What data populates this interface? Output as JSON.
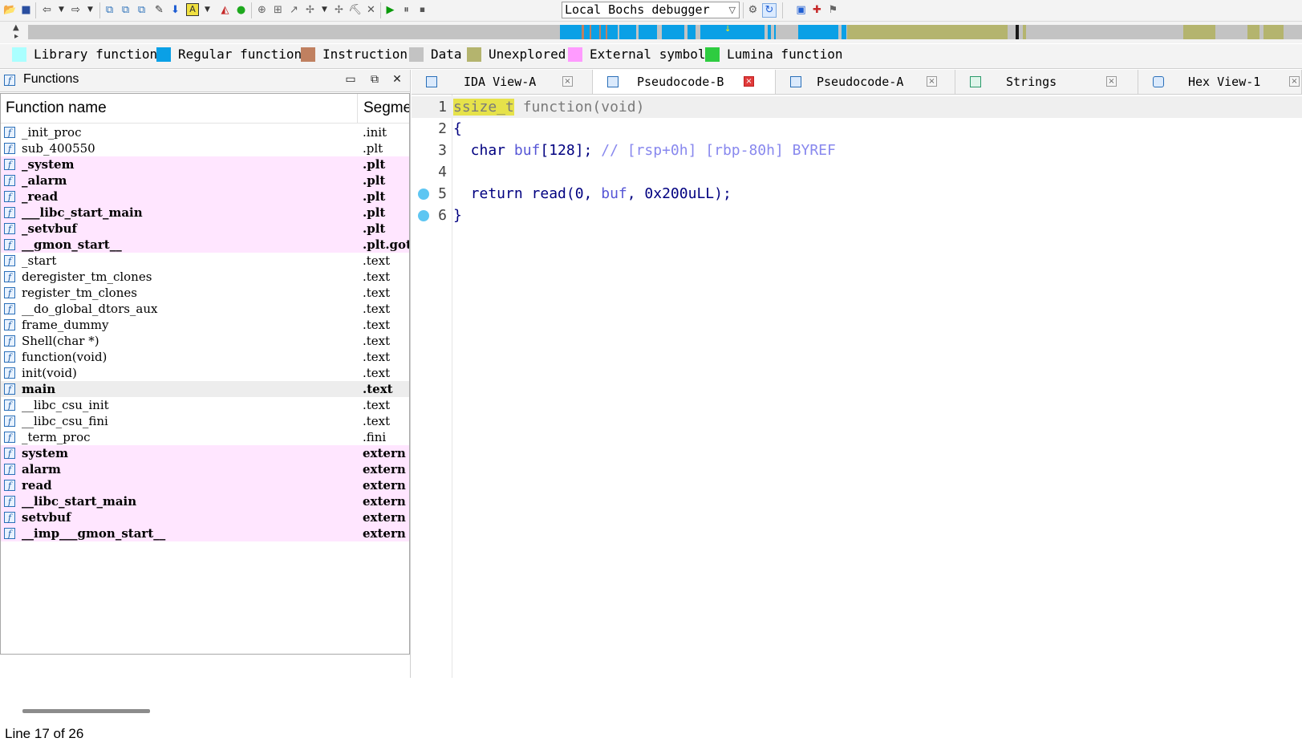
{
  "toolbar": {
    "debugger_select": "Local Bochs debugger"
  },
  "legend": [
    {
      "label": "Library function",
      "color": "#aaffff"
    },
    {
      "label": "Regular function",
      "color": "#0aa0e6"
    },
    {
      "label": "Instruction",
      "color": "#c08060"
    },
    {
      "label": "Data",
      "color": "#c3c3c3"
    },
    {
      "label": "Unexplored",
      "color": "#b4b46e"
    },
    {
      "label": "External symbol",
      "color": "#ff9bff"
    },
    {
      "label": "Lumina function",
      "color": "#2ecc40"
    }
  ],
  "functions_panel": {
    "title": "Functions",
    "col_name": "Function name",
    "col_segment": "Segme",
    "rows": [
      {
        "name": "_init_proc",
        "segment": ".init"
      },
      {
        "name": "sub_400550",
        "segment": ".plt"
      },
      {
        "name": "_system",
        "segment": ".plt"
      },
      {
        "name": "_alarm",
        "segment": ".plt"
      },
      {
        "name": "_read",
        "segment": ".plt"
      },
      {
        "name": "___libc_start_main",
        "segment": ".plt"
      },
      {
        "name": "_setvbuf",
        "segment": ".plt"
      },
      {
        "name": "__gmon_start__",
        "segment": ".plt.got"
      },
      {
        "name": "_start",
        "segment": ".text"
      },
      {
        "name": "deregister_tm_clones",
        "segment": ".text"
      },
      {
        "name": "register_tm_clones",
        "segment": ".text"
      },
      {
        "name": "__do_global_dtors_aux",
        "segment": ".text"
      },
      {
        "name": "frame_dummy",
        "segment": ".text"
      },
      {
        "name": "Shell(char *)",
        "segment": ".text"
      },
      {
        "name": "function(void)",
        "segment": ".text"
      },
      {
        "name": "init(void)",
        "segment": ".text"
      },
      {
        "name": "main",
        "segment": ".text"
      },
      {
        "name": "__libc_csu_init",
        "segment": ".text"
      },
      {
        "name": "__libc_csu_fini",
        "segment": ".text"
      },
      {
        "name": "_term_proc",
        "segment": ".fini"
      },
      {
        "name": "system",
        "segment": "extern"
      },
      {
        "name": "alarm",
        "segment": "extern"
      },
      {
        "name": "read",
        "segment": "extern"
      },
      {
        "name": "__libc_start_main",
        "segment": "extern"
      },
      {
        "name": "setvbuf",
        "segment": "extern"
      },
      {
        "name": "__imp___gmon_start__",
        "segment": "extern"
      }
    ],
    "status": "Line 17 of 26"
  },
  "tabs": [
    {
      "label": "IDA View-A"
    },
    {
      "label": "Pseudocode-B"
    },
    {
      "label": "Pseudocode-A"
    },
    {
      "label": "Strings"
    },
    {
      "label": "Hex View-1"
    }
  ],
  "code": {
    "line_numbers": [
      "1",
      "2",
      "3",
      "4",
      "5",
      "6"
    ],
    "l1_type": "ssize_t",
    "l1_rest": " function(void)",
    "l2": "{",
    "l3_kw": "  char ",
    "l3_var": "buf",
    "l3_rest": "[128]; ",
    "l3_comment": "// [rsp+0h] [rbp-80h] BYREF",
    "l5_kw": "  return read(0, ",
    "l5_var": "buf",
    "l5_rest": ", 0x200uLL);",
    "l6": "}"
  }
}
